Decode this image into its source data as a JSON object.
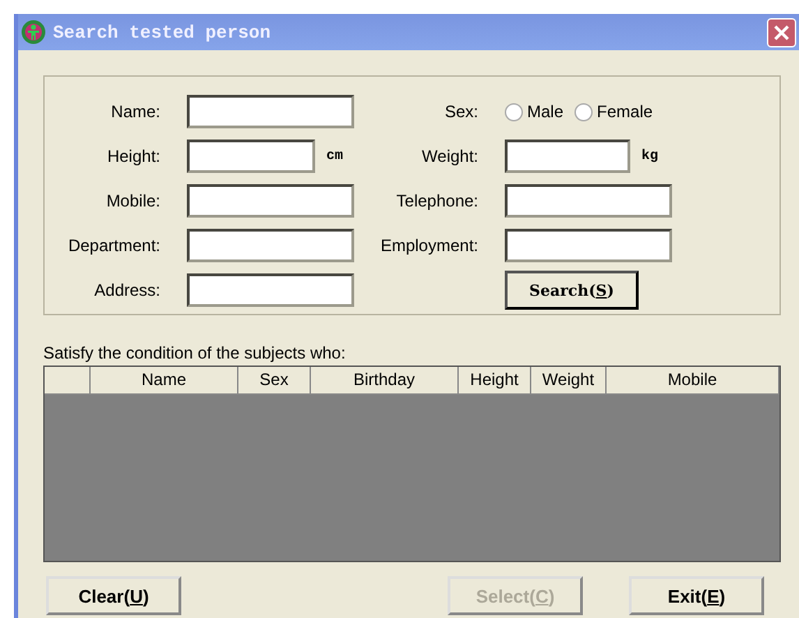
{
  "window": {
    "title": "Search tested person"
  },
  "form": {
    "left": [
      {
        "label": "Name:"
      },
      {
        "label": "Height:",
        "unit": "cm",
        "kind": "short"
      },
      {
        "label": "Mobile:"
      },
      {
        "label": "Department:"
      },
      {
        "label": "Address:"
      }
    ],
    "sex": {
      "label": "Sex:",
      "options": [
        {
          "label": "Male",
          "selected": false
        },
        {
          "label": "Female",
          "selected": false
        }
      ]
    },
    "right": [
      {
        "label": "Weight:",
        "unit": "kg",
        "kind": "short"
      },
      {
        "label": "Telephone:"
      },
      {
        "label": "Employment:"
      }
    ],
    "search_button": {
      "before": "Search(",
      "key": "S",
      "after": ")"
    }
  },
  "results": {
    "caption": "Satisfy the condition of the subjects who:",
    "columns": [
      "",
      "Name",
      "Sex",
      "Birthday",
      "Height",
      "Weight",
      "Mobile"
    ]
  },
  "buttons": [
    {
      "before": "Clear(",
      "key": "U",
      "after": ")",
      "disabled": false
    },
    {
      "before": "Select(",
      "key": "C",
      "after": ")",
      "disabled": true
    },
    {
      "before": "Exit(",
      "key": "E",
      "after": ")",
      "disabled": false
    }
  ]
}
